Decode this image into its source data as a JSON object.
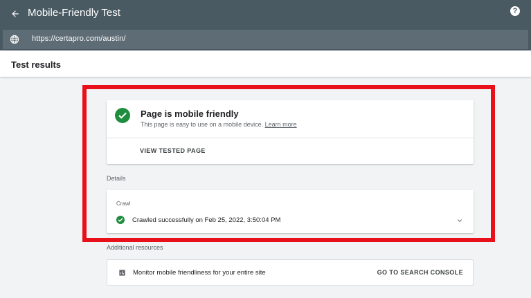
{
  "header": {
    "title": "Mobile-Friendly Test",
    "back_icon": "arrow-left-icon",
    "help_icon": "help-circle-icon",
    "help_glyph": "?"
  },
  "url_bar": {
    "icon": "globe-icon",
    "value": "https://certapro.com/austin/"
  },
  "results": {
    "title": "Test results"
  },
  "summary": {
    "icon": "check-circle-icon",
    "heading": "Page is mobile friendly",
    "description": "This page is easy to use on a mobile device.",
    "learn_more": "Learn more",
    "view_button": "VIEW TESTED PAGE"
  },
  "details": {
    "label": "Details",
    "crawl_title": "Crawl",
    "crawl_status": "Crawled successfully on Feb 25, 2022, 3:50:04 PM",
    "expand_icon": "chevron-down-icon"
  },
  "resources": {
    "label": "Additional resources",
    "icon": "bar-chart-icon",
    "text": "Monitor mobile friendliness for your entire site",
    "button": "GO TO SEARCH CONSOLE"
  },
  "colors": {
    "header_bg": "#4a5a63",
    "success": "#1e8e3e",
    "highlight": "#e8101a"
  }
}
